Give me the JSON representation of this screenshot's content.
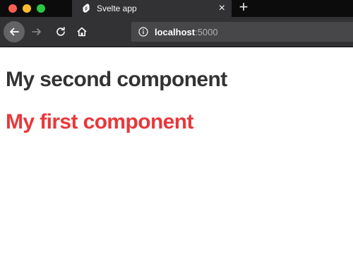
{
  "browser": {
    "tab": {
      "title": "Svelte app",
      "favicon": "svelte-logo-icon",
      "close_icon": "×"
    },
    "new_tab_icon": "+",
    "nav": {
      "back_icon": "arrow-left-icon",
      "forward_icon": "arrow-right-icon",
      "reload_icon": "reload-icon",
      "home_icon": "home-icon"
    },
    "address_bar": {
      "host": "localhost",
      "port": ":5000",
      "info_icon": "info-icon"
    }
  },
  "page": {
    "heading_second": "My second component",
    "heading_first": "My first component"
  },
  "colors": {
    "heading_second": "#333333",
    "heading_first": "#e8383b",
    "tabbar": "#0c0c0d",
    "toolbar": "#323234"
  }
}
